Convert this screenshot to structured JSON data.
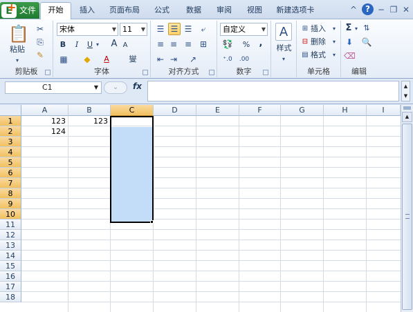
{
  "tabs": {
    "file": "文件",
    "items": [
      "开始",
      "插入",
      "页面布局",
      "公式",
      "数据",
      "审阅",
      "视图",
      "新建选项卡"
    ]
  },
  "window_controls": {
    "help": "?"
  },
  "ribbon": {
    "clipboard": {
      "group": "剪贴板",
      "paste": "粘贴"
    },
    "font": {
      "group": "字体",
      "name": "宋体",
      "size": "11",
      "bold": "B",
      "italic": "I",
      "underline": "U",
      "grow": "A",
      "shrink": "A",
      "color": "A",
      "phonetic": "燮"
    },
    "alignment": {
      "group": "对齐方式"
    },
    "number": {
      "group": "数字",
      "format": "自定义",
      "percent": "%",
      "comma": ","
    },
    "styles": {
      "group": "",
      "label": "样式"
    },
    "cells": {
      "group": "单元格",
      "insert": "插入",
      "delete": "删除",
      "format": "格式"
    },
    "editing": {
      "group": "编辑",
      "sum": "Σ"
    }
  },
  "formula_bar": {
    "name_box": "C1",
    "fx": "fx",
    "value": ""
  },
  "sheet": {
    "columns": [
      "A",
      "B",
      "C",
      "D",
      "E",
      "F",
      "G",
      "H",
      "I"
    ],
    "rows": [
      "1",
      "2",
      "3",
      "4",
      "5",
      "6",
      "7",
      "8",
      "9",
      "10",
      "11",
      "12",
      "13",
      "14",
      "15",
      "16",
      "17",
      "18"
    ],
    "selected_column": "C",
    "selected_range": "C1:C10",
    "cells": {
      "A1": "123",
      "B1": "123",
      "A2": "124"
    }
  },
  "colors": {
    "selection": "#c3dcf7",
    "header_active": "#f1c15f",
    "file_tab": "#1f7a30"
  }
}
